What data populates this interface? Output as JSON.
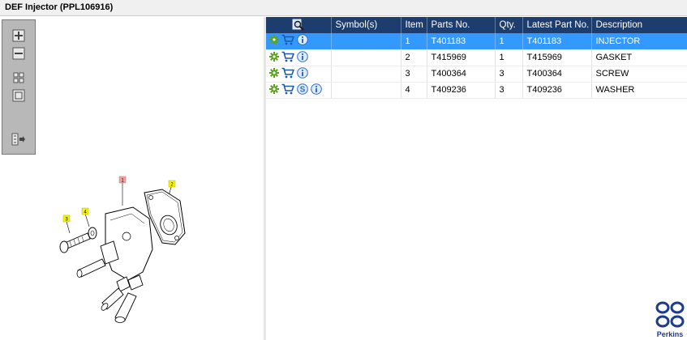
{
  "window": {
    "title": "DEF Injector (PPL106916)"
  },
  "toolbar": {
    "icons": [
      "zoom-in-icon",
      "zoom-out-icon",
      "tile-view-icon",
      "fit-view-icon",
      "export-list-icon"
    ]
  },
  "diagram": {
    "callouts": [
      {
        "label": "1",
        "color": "#f4a0a0"
      },
      {
        "label": "2",
        "color": "#f5f500"
      },
      {
        "label": "3",
        "color": "#f5f500"
      },
      {
        "label": "4",
        "color": "#f5f500"
      }
    ]
  },
  "table": {
    "header_icon": "search-icon",
    "columns": [
      "Symbol(s)",
      "Item",
      "Parts No.",
      "Qty.",
      "Latest Part No.",
      "Description"
    ],
    "rows": [
      {
        "selected": true,
        "icons": [
          "gear-icon",
          "cart-icon",
          "info-icon"
        ],
        "symbol": "",
        "item": "1",
        "part_no": "T401183",
        "qty": "1",
        "latest_part_no": "T401183",
        "description": "INJECTOR"
      },
      {
        "selected": false,
        "icons": [
          "gear-icon",
          "cart-icon",
          "info-icon"
        ],
        "symbol": "",
        "item": "2",
        "part_no": "T415969",
        "qty": "1",
        "latest_part_no": "T415969",
        "description": "GASKET"
      },
      {
        "selected": false,
        "icons": [
          "gear-icon",
          "cart-icon",
          "info-icon"
        ],
        "symbol": "",
        "item": "3",
        "part_no": "T400364",
        "qty": "3",
        "latest_part_no": "T400364",
        "description": "SCREW"
      },
      {
        "selected": false,
        "icons": [
          "gear-icon",
          "cart-icon",
          "s-icon",
          "info-icon"
        ],
        "symbol": "",
        "item": "4",
        "part_no": "T409236",
        "qty": "3",
        "latest_part_no": "T409236",
        "description": "WASHER"
      }
    ]
  },
  "brand": {
    "name": "Perkins",
    "color": "#1c3d8c"
  },
  "colors": {
    "header_bg": "#1c3d6e",
    "selected_row": "#3399ff",
    "gear": "#5aa21e",
    "cart": "#1e5aa8",
    "info": "#2a6fc4"
  }
}
